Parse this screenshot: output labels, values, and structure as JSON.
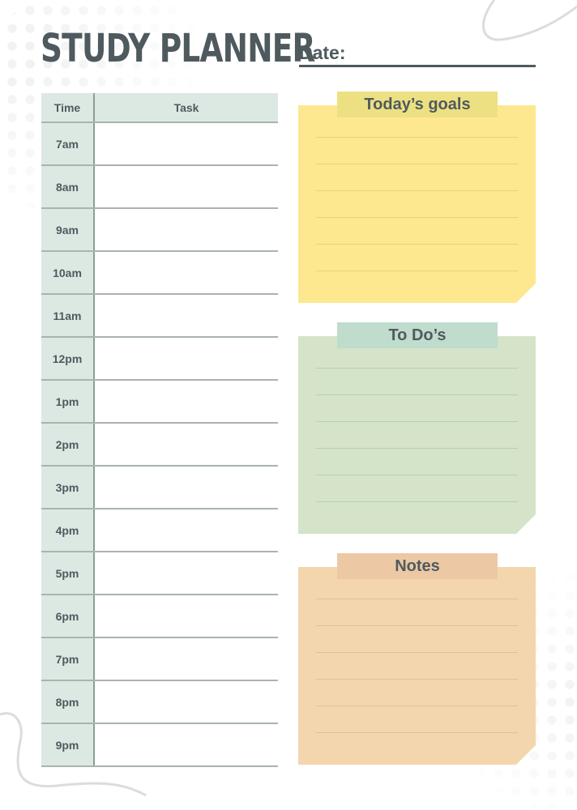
{
  "header": {
    "title": "STUDY PLANNER",
    "date_label": "Date:"
  },
  "schedule": {
    "columns": [
      "Time",
      "Task"
    ],
    "rows": [
      {
        "time": "7am",
        "task": ""
      },
      {
        "time": "8am",
        "task": ""
      },
      {
        "time": "9am",
        "task": ""
      },
      {
        "time": "10am",
        "task": ""
      },
      {
        "time": "11am",
        "task": ""
      },
      {
        "time": "12pm",
        "task": ""
      },
      {
        "time": "1pm",
        "task": ""
      },
      {
        "time": "2pm",
        "task": ""
      },
      {
        "time": "3pm",
        "task": ""
      },
      {
        "time": "4pm",
        "task": ""
      },
      {
        "time": "5pm",
        "task": ""
      },
      {
        "time": "6pm",
        "task": ""
      },
      {
        "time": "7pm",
        "task": ""
      },
      {
        "time": "8pm",
        "task": ""
      },
      {
        "time": "9pm",
        "task": ""
      }
    ]
  },
  "notes": [
    {
      "title": "Today’s goals",
      "color": "#fde890",
      "tab_color": "#ede082",
      "lines": 6
    },
    {
      "title": "To Do’s",
      "color": "#d5e3c8",
      "tab_color": "#bfdccd",
      "lines": 6
    },
    {
      "title": "Notes",
      "color": "#f4d6ae",
      "tab_color": "#ecc9a4",
      "lines": 6
    }
  ],
  "colors": {
    "text": "#4f5a5f",
    "table_header": "#dce9e2"
  }
}
